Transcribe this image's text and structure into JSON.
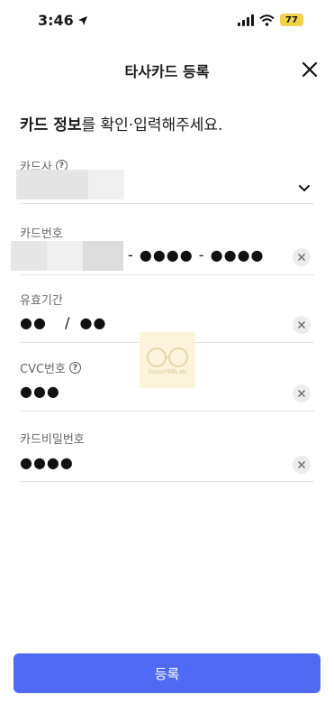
{
  "status": {
    "time": "3:46",
    "battery": "77"
  },
  "header": {
    "title": "타사카드 등록"
  },
  "intro": {
    "bold": "카드 정보",
    "rest": "를 확인·입력해주세요."
  },
  "fields": {
    "card_company": {
      "label": "카드사"
    },
    "card_number": {
      "label": "카드번호",
      "masked": "- ●●●● - ●●●●"
    },
    "expiry": {
      "label": "유효기간",
      "month": "●●",
      "separator": "/",
      "year": "●●"
    },
    "cvc": {
      "label": "CVC번호",
      "value": "●●●"
    },
    "password": {
      "label": "카드비밀번호",
      "value": "●●●●"
    }
  },
  "watermark": {
    "text": "SuuuYMiLab"
  },
  "submit": {
    "label": "등록"
  },
  "colors": {
    "accent": "#4f6af5",
    "battery": "#f1d24a"
  }
}
